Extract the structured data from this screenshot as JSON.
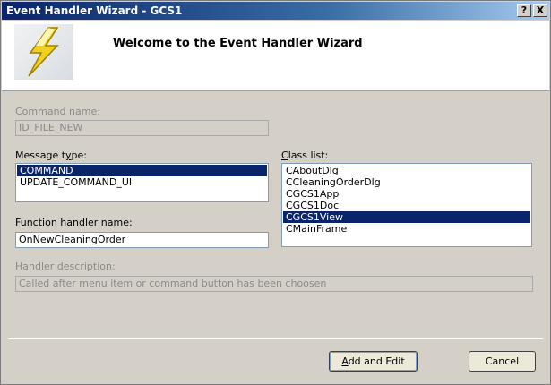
{
  "window": {
    "title": "Event Handler Wizard - GCS1",
    "help_glyph": "?",
    "close_glyph": "X"
  },
  "header": {
    "welcome": "Welcome to the Event Handler Wizard",
    "logo_icon": "lightning-bolt-icon"
  },
  "command": {
    "label": "Command name:",
    "value": "ID_FILE_NEW"
  },
  "message_type": {
    "label_pre": "Message t",
    "label_u": "y",
    "label_post": "pe:",
    "items": [
      "COMMAND",
      "UPDATE_COMMAND_UI"
    ],
    "selected": 0
  },
  "class_list": {
    "label_u": "C",
    "label_post": "lass list:",
    "items": [
      "CAboutDlg",
      "CCleaningOrderDlg",
      "CGCS1App",
      "CGCS1Doc",
      "CGCS1View",
      "CMainFrame"
    ],
    "selected": 4
  },
  "function_handler": {
    "label_pre": "Function handler ",
    "label_u": "n",
    "label_post": "ame:",
    "value": "OnNewCleaningOrder"
  },
  "handler_description": {
    "label": "Handler description:",
    "value": "Called after menu item or command button has been choosen"
  },
  "buttons": {
    "add_edit_u": "A",
    "add_edit_post": "dd and Edit",
    "cancel": "Cancel"
  },
  "colors": {
    "selection": "#0a246a",
    "titlebar_start": "#0a246a",
    "dialog_bg": "#d4d0c8"
  }
}
